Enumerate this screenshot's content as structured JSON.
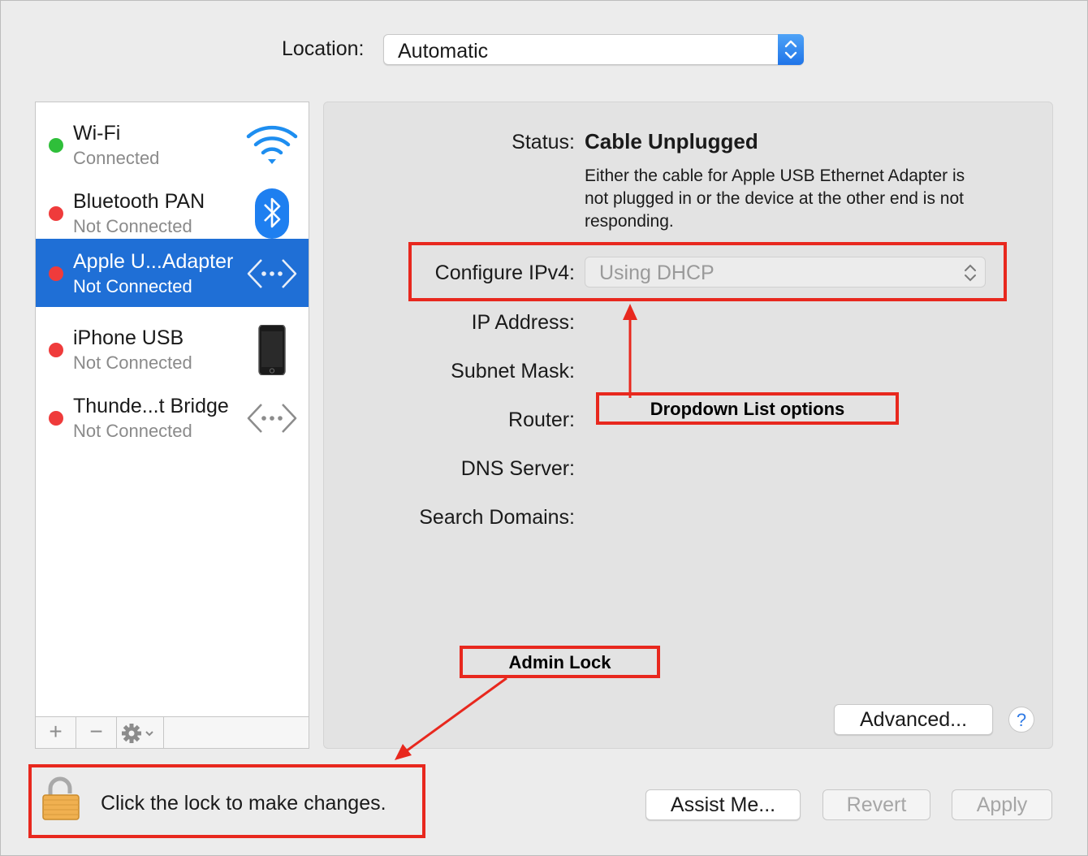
{
  "location": {
    "label": "Location:",
    "value": "Automatic"
  },
  "services": [
    {
      "name": "Wi-Fi",
      "status": "Connected",
      "status_color": "#2fbf3a",
      "icon": "wifi-icon",
      "selected": false
    },
    {
      "name": "Bluetooth PAN",
      "status": "Not Connected",
      "status_color": "#ef3b3b",
      "icon": "bluetooth-icon",
      "selected": false
    },
    {
      "name": "Apple U...Adapter",
      "status": "Not Connected",
      "status_color": "#ef3b3b",
      "icon": "ethernet-icon",
      "selected": true
    },
    {
      "name": "iPhone USB",
      "status": "Not Connected",
      "status_color": "#ef3b3b",
      "icon": "iphone-icon",
      "selected": false
    },
    {
      "name": "Thunde...t Bridge",
      "status": "Not Connected",
      "status_color": "#ef3b3b",
      "icon": "ethernet-icon",
      "selected": false
    }
  ],
  "list_toolbar": {
    "add": "+",
    "remove": "−"
  },
  "detail": {
    "status_label": "Status:",
    "status_value": "Cable Unplugged",
    "status_description": "Either the cable for Apple USB Ethernet Adapter is not plugged in or the device at the other end is not responding.",
    "ipv4_label": "Configure IPv4:",
    "ipv4_value": "Using DHCP",
    "ip_label": "IP Address:",
    "subnet_label": "Subnet Mask:",
    "router_label": "Router:",
    "dns_label": "DNS Server:",
    "search_label": "Search Domains:",
    "advanced_button": "Advanced...",
    "help_button": "?"
  },
  "footer": {
    "lock_text": "Click the lock to make changes.",
    "assist_button": "Assist Me...",
    "revert_button": "Revert",
    "apply_button": "Apply"
  },
  "annotations": {
    "dropdown_label": "Dropdown List options",
    "lock_label": "Admin Lock",
    "color": "#e8281e"
  },
  "colors": {
    "accent": "#1f6fd6",
    "window_bg": "#ececec"
  }
}
